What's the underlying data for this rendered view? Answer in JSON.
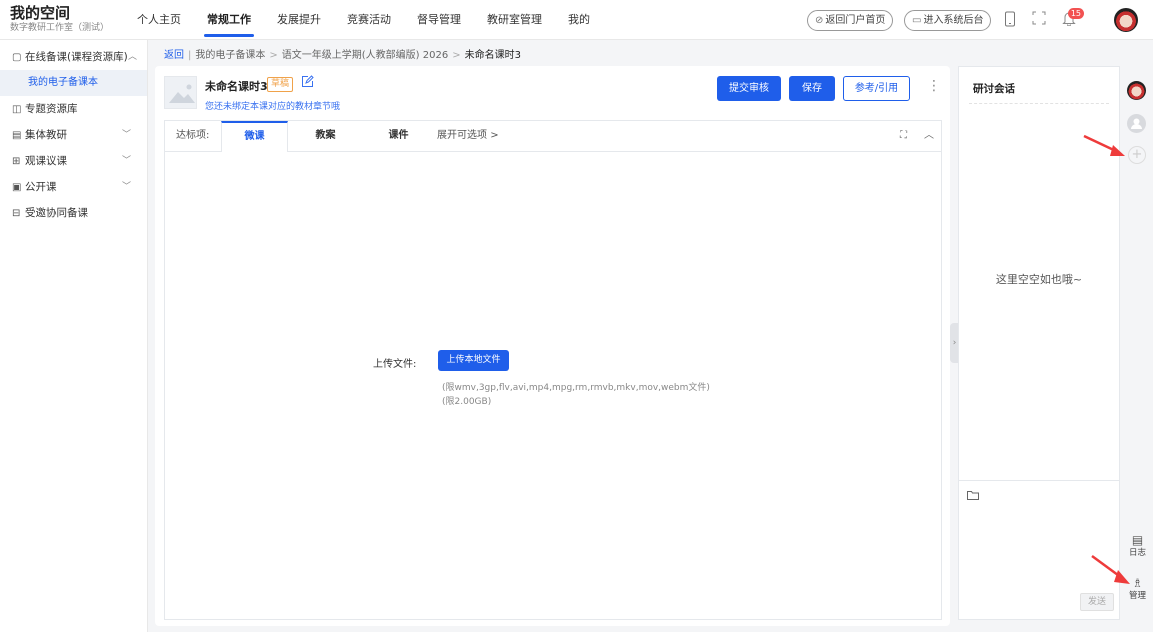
{
  "brand": {
    "title": "我的空间",
    "subtitle": "数字教研工作室（测试）"
  },
  "nav": [
    {
      "label": "个人主页",
      "active": false
    },
    {
      "label": "常规工作",
      "active": true
    },
    {
      "label": "发展提升",
      "active": false
    },
    {
      "label": "竞赛活动",
      "active": false
    },
    {
      "label": "督导管理",
      "active": false
    },
    {
      "label": "教研室管理",
      "active": false
    },
    {
      "label": "我的",
      "active": false
    }
  ],
  "topright": {
    "portal": "返回门户首页",
    "backend": "进入系统后台",
    "notification_count": "15"
  },
  "sidebar": {
    "items": [
      {
        "label": "在线备课(课程资源库)",
        "icon": "doc-icon",
        "chevron": "up"
      },
      {
        "label": "专题资源库",
        "icon": "folder-icon"
      },
      {
        "label": "集体教研",
        "icon": "list-icon",
        "chevron": "down"
      },
      {
        "label": "观课议课",
        "icon": "observe-icon",
        "chevron": "down"
      },
      {
        "label": "公开课",
        "icon": "screen-icon",
        "chevron": "down"
      },
      {
        "label": "受邀协同备课",
        "icon": "collab-icon"
      }
    ],
    "sub_item": "我的电子备课本"
  },
  "breadcrumb": {
    "back": "返回",
    "path1": "我的电子备课本",
    "path2": "语文一年级上学期(人教部编版) 2026",
    "current": "未命名课时3"
  },
  "lesson": {
    "title": "未命名课时3",
    "status": "草稿",
    "hint": "您还未绑定本课对应的教材章节哦"
  },
  "actions": {
    "submit": "提交审核",
    "save": "保存",
    "reference": "参考/引用"
  },
  "tabs": {
    "label": "达标项:",
    "items": [
      "微课",
      "教案",
      "课件"
    ],
    "active": "微课",
    "more": "展开可选项"
  },
  "upload": {
    "label": "上传文件:",
    "button": "上传本地文件",
    "formats": "(限wmv,3gp,flv,avi,mp4,mpg,rm,rmvb,mkv,mov,webm文件)",
    "size": "(限2.00GB)"
  },
  "discussion": {
    "title": "研讨会话",
    "empty": "这里空空如也哦~",
    "send": "发送"
  },
  "rail": {
    "log": "日志",
    "manage": "管理"
  },
  "colors": {
    "accent": "#1f5eea",
    "draft": "#f0a24a",
    "badge": "#f25252",
    "arrow": "#ee3b3b"
  }
}
